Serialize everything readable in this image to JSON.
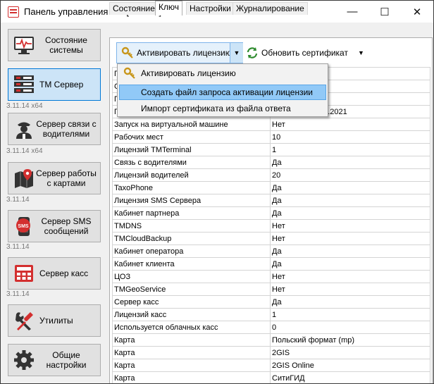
{
  "window": {
    "title": "Панель управления ТМ [3.11.14]"
  },
  "controls": {
    "minimize": "—",
    "maximize": "☐",
    "close": "✕"
  },
  "sidebar": {
    "items": [
      {
        "label": "Состояние системы",
        "version": ""
      },
      {
        "label": "TM Сервер",
        "version": "3.11.14 x64"
      },
      {
        "label": "Сервер связи с водителями",
        "version": "3.11.14 x64"
      },
      {
        "label": "Сервер работы с картами",
        "version": "3.11.14"
      },
      {
        "label": "Сервер SMS сообщений",
        "version": "3.11.14"
      },
      {
        "label": "Сервер касс",
        "version": "3.11.14"
      },
      {
        "label": "Утилиты",
        "version": ""
      },
      {
        "label": "Общие настройки",
        "version": ""
      }
    ]
  },
  "tabs": [
    "Состояние",
    "Ключ",
    "Настройки",
    "Журналирование"
  ],
  "toolbar": {
    "activate_label": "Активировать лицензию",
    "update_label": "Обновить сертификат"
  },
  "menu": {
    "items": [
      "Активировать лицензию",
      "Создать файл запроса активации лицензии",
      "Импорт сертификата из файла ответа"
    ]
  },
  "grid": {
    "partial_first_letter": "П",
    "row2_first_letter": "С",
    "row3_first_letter": "П",
    "row4_first_letter": "П",
    "row4_value_tail": "12.2021",
    "rows": [
      [
        "Запуск на виртуальной машине",
        "Нет"
      ],
      [
        "Рабочих мест",
        "10"
      ],
      [
        "Лицензий TMTerminal",
        "1"
      ],
      [
        "Связь с водителями",
        "Да"
      ],
      [
        "Лицензий водителей",
        "20"
      ],
      [
        "TaxoPhone",
        "Да"
      ],
      [
        "Лицензия SMS Сервера",
        "Да"
      ],
      [
        "Кабинет партнера",
        "Да"
      ],
      [
        "TMDNS",
        "Нет"
      ],
      [
        "TMCloudBackup",
        "Нет"
      ],
      [
        "Кабинет оператора",
        "Да"
      ],
      [
        "Кабинет клиента",
        "Да"
      ],
      [
        "ЦОЗ",
        "Нет"
      ],
      [
        "TMGeoService",
        "Нет"
      ],
      [
        "Сервер касс",
        "Да"
      ],
      [
        "Лицензий касс",
        "1"
      ],
      [
        "Используется облачных касс",
        "0"
      ],
      [
        "Карта",
        "Польский формат (mp)"
      ],
      [
        "Карта",
        "2GIS"
      ],
      [
        "Карта",
        "2GIS Online"
      ],
      [
        "Карта",
        "СитиГИД"
      ]
    ]
  },
  "colors": {
    "accent": "#0078d7",
    "selected": "#cce4f7",
    "menu_highlight": "#91c9f7",
    "icon_red": "#d32f2f",
    "icon_dark": "#333333"
  }
}
